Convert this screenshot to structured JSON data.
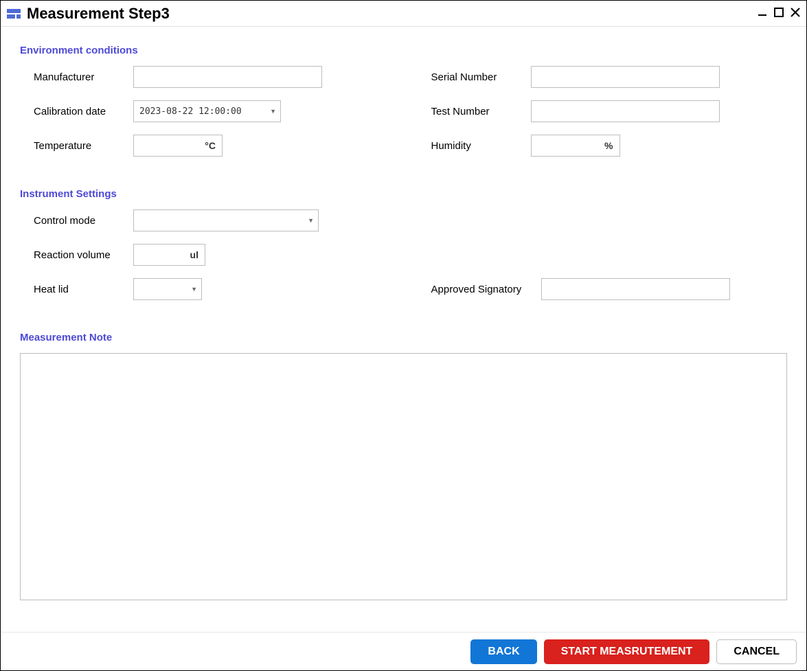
{
  "window": {
    "title": "Measurement Step3"
  },
  "sections": {
    "env": {
      "heading": "Environment conditions",
      "manufacturer_label": "Manufacturer",
      "manufacturer_value": "",
      "serial_label": "Serial Number",
      "serial_value": "",
      "calib_date_label": "Calibration date",
      "calib_date_value": "2023-08-22 12:00:00",
      "test_number_label": "Test Number",
      "test_number_value": "",
      "temperature_label": "Temperature",
      "temperature_value": "",
      "temperature_unit": "°C",
      "humidity_label": "Humidity",
      "humidity_value": "",
      "humidity_unit": "%"
    },
    "instr": {
      "heading": "Instrument Settings",
      "control_mode_label": "Control mode",
      "control_mode_value": "",
      "reaction_vol_label": "Reaction volume",
      "reaction_vol_value": "",
      "reaction_vol_unit": "ul",
      "heat_lid_label": "Heat lid",
      "heat_lid_value": "",
      "approved_sig_label": "Approved Signatory",
      "approved_sig_value": ""
    },
    "note": {
      "heading": "Measurement Note",
      "value": ""
    }
  },
  "footer": {
    "back": "BACK",
    "start": "START MEASRUTEMENT",
    "cancel": "CANCEL"
  }
}
